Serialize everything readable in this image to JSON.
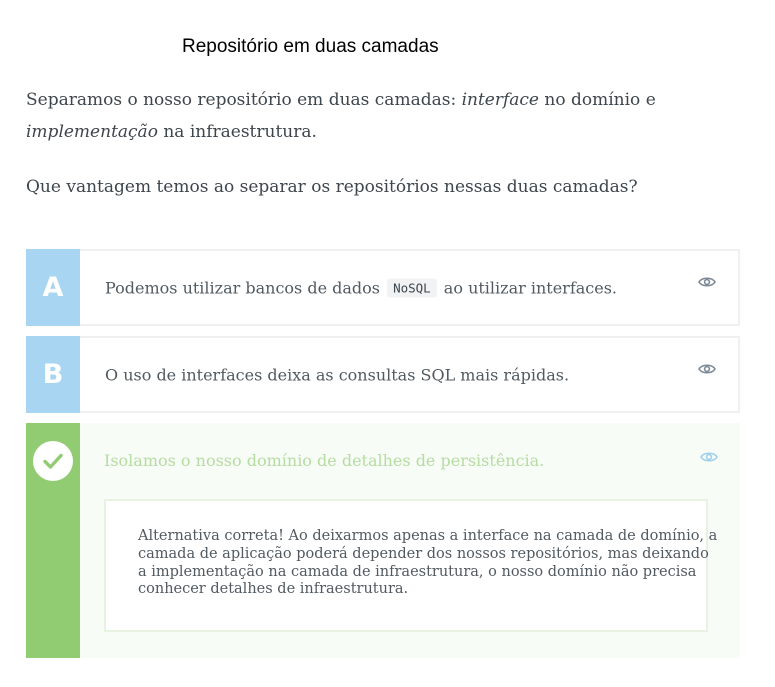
{
  "title": "Repositório em duas camadas",
  "intro": {
    "line1_pre": "Separamos o nosso repositório em duas camadas: ",
    "line1_em": "interface",
    "line1_post": " no domínio e",
    "line2_em": "implementação",
    "line2_post": " na infraestrutura."
  },
  "question": "Que vantagem temos ao separar os repositórios nessas duas camadas?",
  "alternatives": [
    {
      "letter": "A",
      "text_pre": "Podemos utilizar bancos de dados ",
      "code": "NoSQL",
      "text_post": " ao utilizar interfaces.",
      "icon": "eye-icon"
    },
    {
      "letter": "B",
      "text": "O uso de interfaces deixa as consultas SQL mais rápidas.",
      "icon": "eye-icon"
    },
    {
      "status": "correct",
      "icon": "check-icon",
      "text": "Isolamos o nosso domínio de detalhes de persistência.",
      "explanation_lines": [
        "Alternativa correta! Ao deixarmos apenas a interface na camada de domínio, a",
        "camada de aplicação poderá depender dos nossos repositórios, mas deixando",
        "a implementação na camada de infraestrutura, o nosso domínio não precisa",
        "conhecer detalhes de infraestrutura."
      ]
    }
  ],
  "colors": {
    "letter_bg": "#a8d6f2",
    "correct_bar": "#92cc72",
    "correct_text": "#b5dca1",
    "eye_icon": "#7d8a96",
    "eye_icon_active": "#9fd0ec"
  }
}
